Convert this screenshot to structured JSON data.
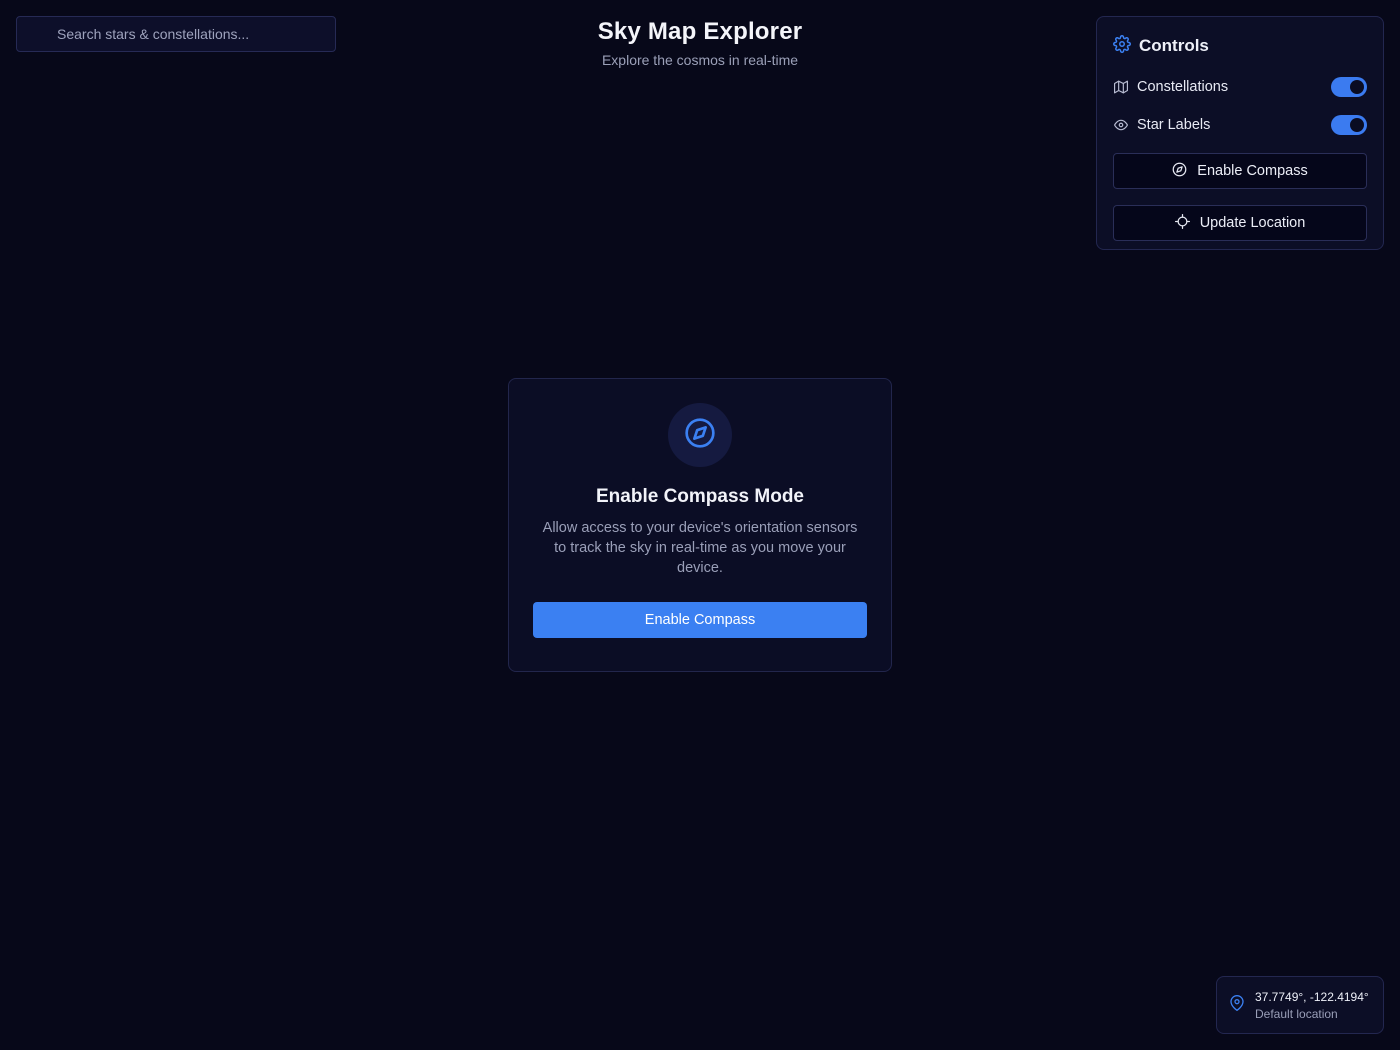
{
  "search": {
    "placeholder": "Search stars & constellations..."
  },
  "header": {
    "title": "Sky Map Explorer",
    "subtitle": "Explore the cosmos in real-time"
  },
  "controls": {
    "title": "Controls",
    "toggles": [
      {
        "label": "Constellations",
        "on": true,
        "icon": "map-icon"
      },
      {
        "label": "Star Labels",
        "on": true,
        "icon": "eye-icon"
      }
    ],
    "buttons": [
      {
        "label": "Enable Compass",
        "icon": "compass-icon"
      },
      {
        "label": "Update Location",
        "icon": "crosshair-icon"
      }
    ]
  },
  "modal": {
    "title": "Enable Compass Mode",
    "description": "Allow access to your device's orientation sensors to track the sky in real-time as you move your device.",
    "button_label": "Enable Compass",
    "icon": "compass-icon"
  },
  "location": {
    "coords": "37.7749°, -122.4194°",
    "label": "Default location",
    "icon": "map-pin-icon"
  },
  "colors": {
    "background": "#070819",
    "accent": "#3b80f2",
    "panel": "#0c0e26",
    "muted_text": "#9a9fb8"
  }
}
